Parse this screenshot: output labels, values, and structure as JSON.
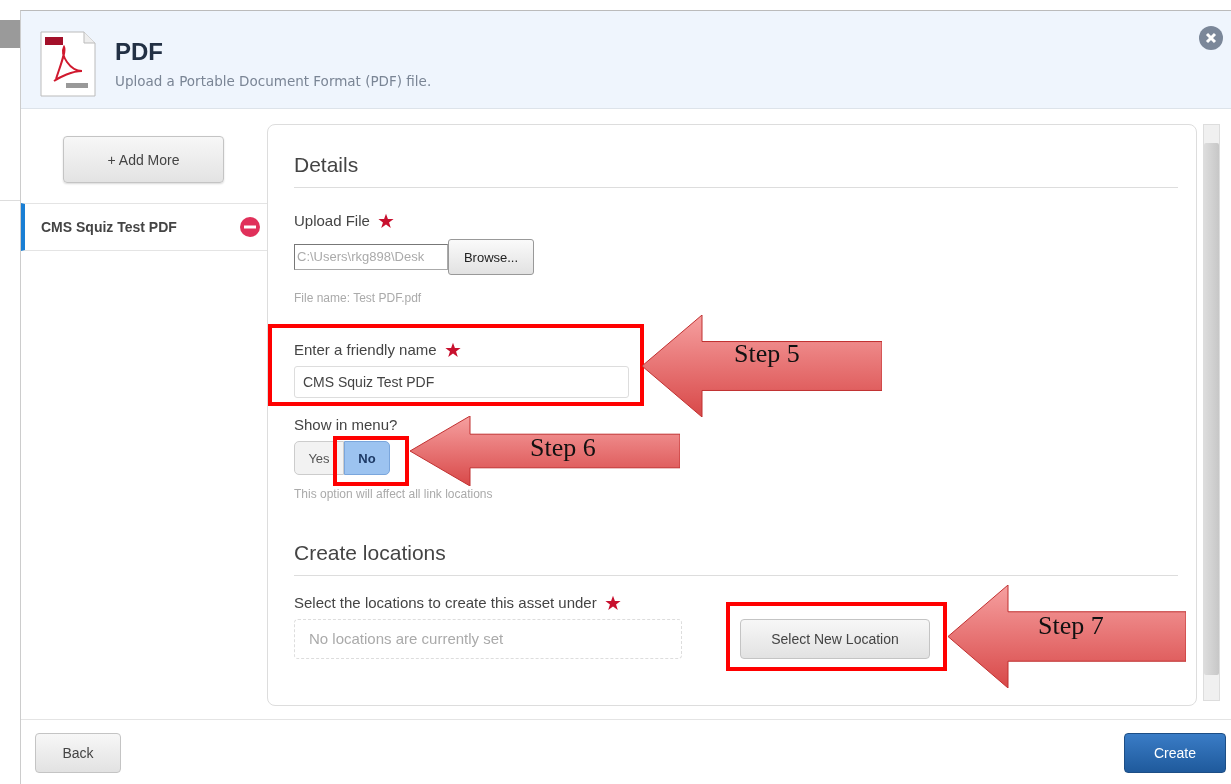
{
  "dialog": {
    "title": "PDF",
    "subtitle": "Upload a Portable Document Format (PDF) file."
  },
  "sidebar": {
    "add_button": "+ Add More",
    "items": [
      {
        "label": "CMS Squiz Test PDF",
        "selected": true
      }
    ]
  },
  "details": {
    "heading": "Details",
    "upload_label": "Upload File",
    "upload_required": true,
    "file_path": "C:\\Users\\rkg898\\Desk",
    "browse_button": "Browse...",
    "file_name": "File name: Test PDF.pdf",
    "name_label": "Enter a friendly name",
    "name_required": true,
    "name_value": "CMS Squiz Test PDF",
    "menu_label": "Show in menu?",
    "menu_options": [
      {
        "label": "Yes",
        "selected": false
      },
      {
        "label": "No",
        "selected": true
      }
    ],
    "menu_hint": "This option will affect all link locations"
  },
  "locations": {
    "heading": "Create locations",
    "label": "Select the locations to create this asset under",
    "required": true,
    "empty_text": "No locations are currently set",
    "select_button": "Select New Location"
  },
  "footer": {
    "back_button": "Back",
    "create_button": "Create"
  },
  "annotations": [
    {
      "label": "Step 5"
    },
    {
      "label": "Step 6"
    },
    {
      "label": "Step 7"
    }
  ]
}
